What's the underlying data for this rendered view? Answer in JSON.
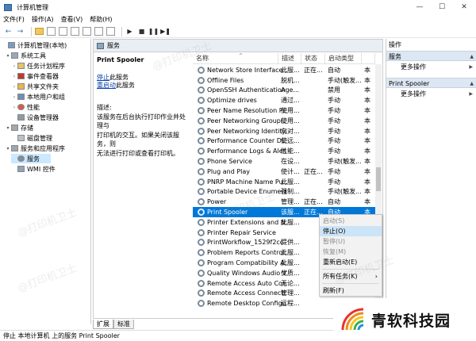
{
  "window": {
    "title": "计算机管理",
    "minimize": "—",
    "maximize": "☐",
    "close": "✕"
  },
  "menu": [
    "文件(F)",
    "操作(A)",
    "查看(V)",
    "帮助(H)"
  ],
  "tree": {
    "items": [
      {
        "label": "计算机管理(本地)",
        "level": 0,
        "expander": ""
      },
      {
        "label": "系统工具",
        "level": 1,
        "expander": "▾"
      },
      {
        "label": "任务计划程序",
        "level": 2,
        "expander": "›"
      },
      {
        "label": "事件查看器",
        "level": 2,
        "expander": "›"
      },
      {
        "label": "共享文件夹",
        "level": 2,
        "expander": "›"
      },
      {
        "label": "本地用户和组",
        "level": 2,
        "expander": "›"
      },
      {
        "label": "性能",
        "level": 2,
        "expander": "›"
      },
      {
        "label": "设备管理器",
        "level": 2,
        "expander": ""
      },
      {
        "label": "存储",
        "level": 1,
        "expander": "▾"
      },
      {
        "label": "磁盘管理",
        "level": 2,
        "expander": ""
      },
      {
        "label": "服务和应用程序",
        "level": 1,
        "expander": "▾"
      },
      {
        "label": "服务",
        "level": 2,
        "expander": "",
        "selected": true
      },
      {
        "label": "WMI 控件",
        "level": 2,
        "expander": ""
      }
    ]
  },
  "middle": {
    "header": "服务",
    "service_title": "Print Spooler",
    "stop_link": "停止",
    "stop_suffix": "此服务",
    "restart_link": "重启动",
    "restart_suffix": "此服务",
    "desc_label": "描述:",
    "desc_lines": [
      "该服务在后台执行打印作业并处理与",
      "打印机的交互。如果关闭该服务，则",
      "无法进行打印或查看打印机。"
    ]
  },
  "columns": {
    "name": "名称",
    "desc": "描述",
    "status": "状态",
    "startup": "启动类型",
    "sort_indicator": "^"
  },
  "services": [
    {
      "name": "Network Store Interface ...",
      "desc": "此服...",
      "status": "正在...",
      "startup": "自动",
      "cut": "本"
    },
    {
      "name": "Offline Files",
      "desc": "脱机...",
      "status": "",
      "startup": "手动(触发...",
      "cut": "本"
    },
    {
      "name": "OpenSSH Authentication ...",
      "desc": "Age...",
      "status": "",
      "startup": "禁用",
      "cut": "本"
    },
    {
      "name": "Optimize drives",
      "desc": "通过...",
      "status": "",
      "startup": "手动",
      "cut": "本"
    },
    {
      "name": "Peer Name Resolution Pr...",
      "desc": "使用...",
      "status": "",
      "startup": "手动",
      "cut": "本"
    },
    {
      "name": "Peer Networking Groupi...",
      "desc": "使用...",
      "status": "",
      "startup": "手动",
      "cut": "本"
    },
    {
      "name": "Peer Networking Identity...",
      "desc": "向对...",
      "status": "",
      "startup": "手动",
      "cut": "本"
    },
    {
      "name": "Performance Counter DL...",
      "desc": "使远...",
      "status": "",
      "startup": "手动",
      "cut": "本"
    },
    {
      "name": "Performance Logs & Aler...",
      "desc": "性能...",
      "status": "",
      "startup": "手动",
      "cut": "本"
    },
    {
      "name": "Phone Service",
      "desc": "在设...",
      "status": "",
      "startup": "手动(触发...",
      "cut": "本"
    },
    {
      "name": "Plug and Play",
      "desc": "使计...",
      "status": "正在...",
      "startup": "手动",
      "cut": "本"
    },
    {
      "name": "PNRP Machine Name Pu...",
      "desc": "此服...",
      "status": "",
      "startup": "手动",
      "cut": "本"
    },
    {
      "name": "Portable Device Enumera...",
      "desc": "强制...",
      "status": "",
      "startup": "手动(触发...",
      "cut": "本"
    },
    {
      "name": "Power",
      "desc": "管理...",
      "status": "正在...",
      "startup": "自动",
      "cut": "本"
    },
    {
      "name": "Print Spooler",
      "desc": "该服...",
      "status": "正在...",
      "startup": "自动",
      "cut": "本",
      "selected": true
    },
    {
      "name": "Printer Extensions and N...",
      "desc": "此服...",
      "status": "",
      "startup": "",
      "cut": ""
    },
    {
      "name": "Printer Repair Service",
      "desc": "",
      "status": "",
      "startup": "",
      "cut": ""
    },
    {
      "name": "PrintWorkflow_1529f2cc",
      "desc": "提供...",
      "status": "",
      "startup": "",
      "cut": ""
    },
    {
      "name": "Problem Reports Control...",
      "desc": "此服...",
      "status": "",
      "startup": "",
      "cut": ""
    },
    {
      "name": "Program Compatibility A...",
      "desc": "此服...",
      "status": "",
      "startup": "",
      "cut": ""
    },
    {
      "name": "Quality Windows Audio V...",
      "desc": "优质...",
      "status": "",
      "startup": "",
      "cut": ""
    },
    {
      "name": "Remote Access Auto Con...",
      "desc": "无论...",
      "status": "",
      "startup": "",
      "cut": ""
    },
    {
      "name": "Remote Access Connecti...",
      "desc": "管理...",
      "status": "",
      "startup": "",
      "cut": ""
    },
    {
      "name": "Remote Desktop Configu...",
      "desc": "远程...",
      "status": "",
      "startup": "",
      "cut": ""
    }
  ],
  "context_menu": {
    "start": "启动(S)",
    "stop": "停止(O)",
    "pause": "暂停(U)",
    "resume": "恢复(M)",
    "restart": "重新启动(E)",
    "all_tasks": "所有任务(K)",
    "all_tasks_arrow": "›",
    "refresh": "刷新(F)"
  },
  "tabs": {
    "extended": "扩展",
    "standard": "标准"
  },
  "actions": {
    "title": "操作",
    "section1": "服务",
    "more1": "更多操作",
    "section2": "Print Spooler",
    "more2": "更多操作",
    "arrow": "▲",
    "sub_arrow": "▶"
  },
  "statusbar": "停止 本地计算机 上的服务 Print Spooler",
  "watermark": {
    "logo_text": "青软科技园",
    "faint_text": "@打印机卫士"
  },
  "colors": {
    "selection": "#0078d7",
    "link": "#0645ad",
    "header_band": "#dde7f3"
  }
}
